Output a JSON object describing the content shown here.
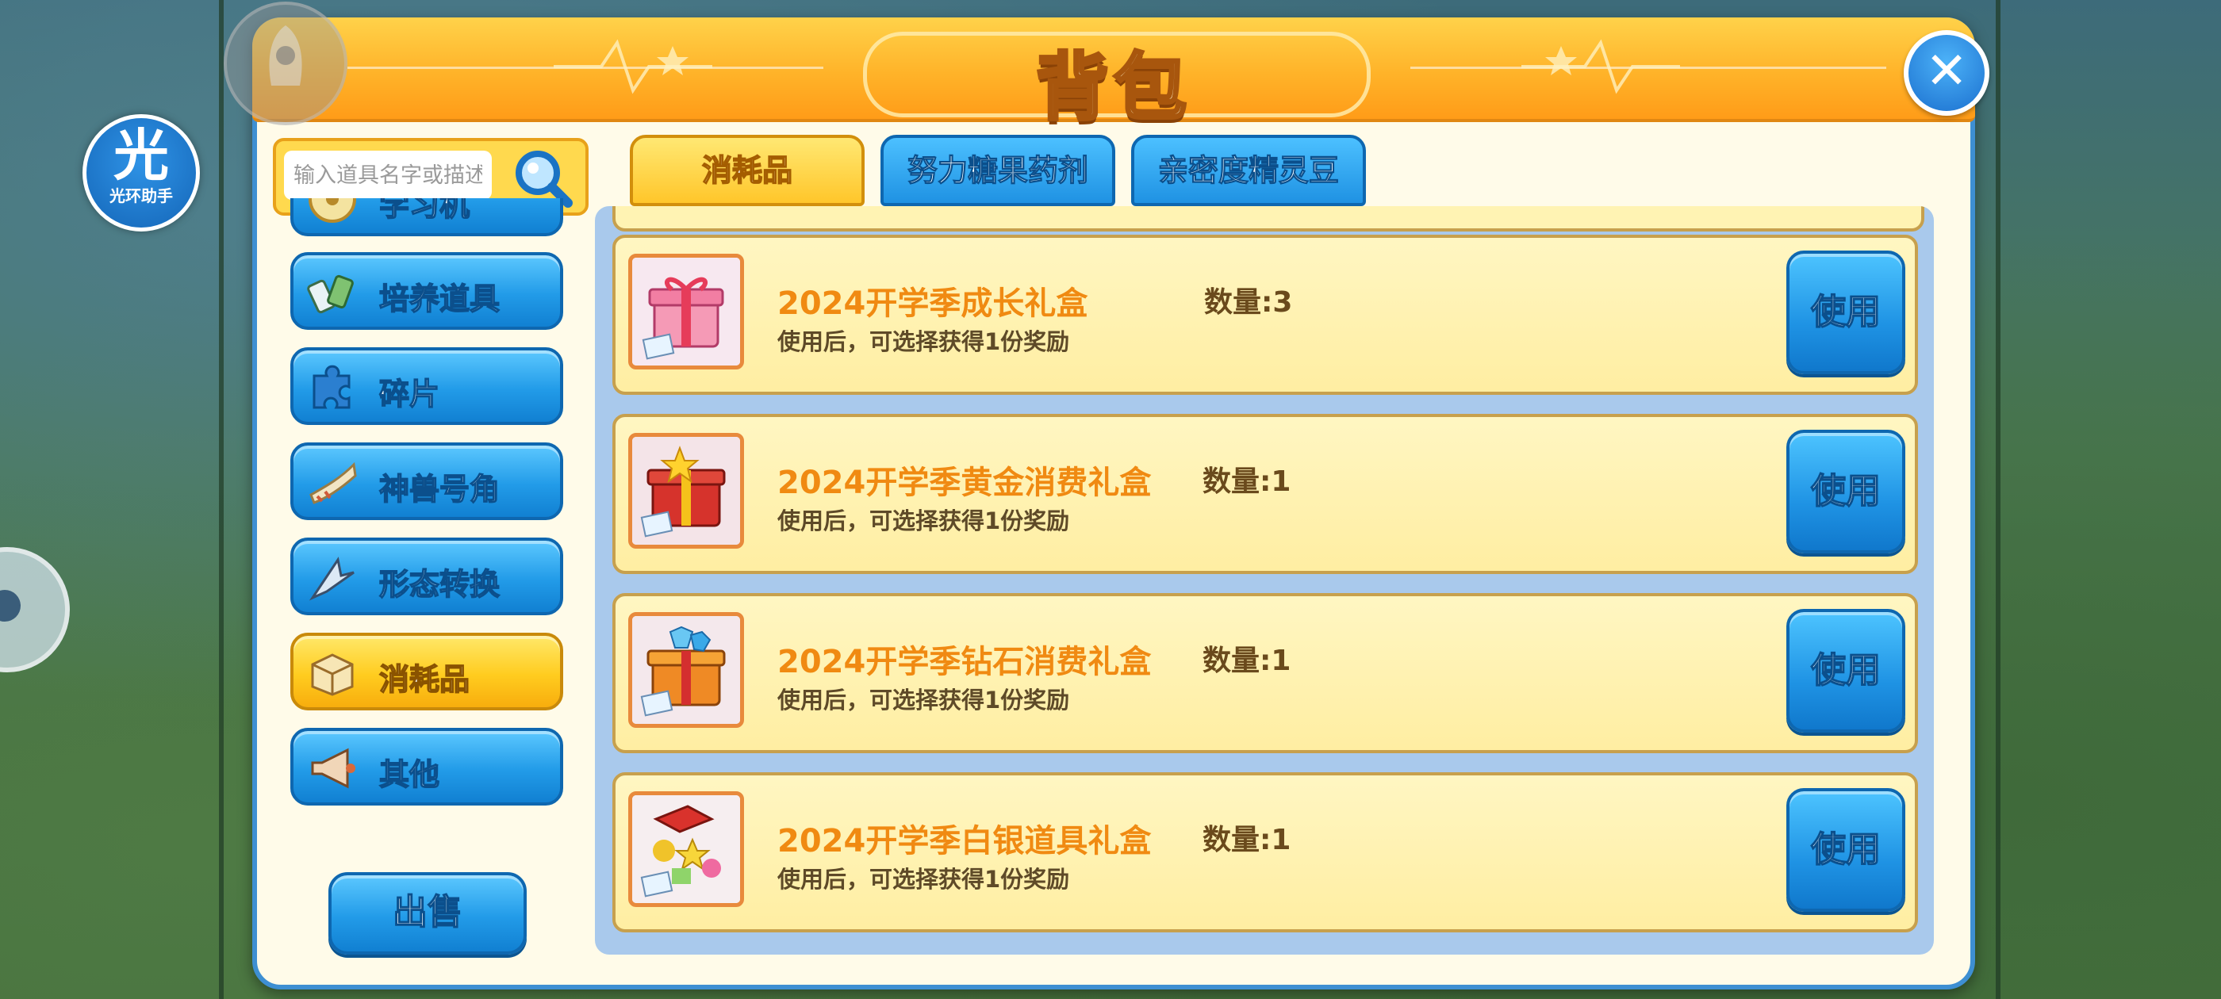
{
  "header": {
    "title": "背包"
  },
  "helper": {
    "glyph": "光",
    "label": "光环助手"
  },
  "search": {
    "placeholder": "输入道具名字或描述"
  },
  "categories": [
    {
      "label": "学习机",
      "icon": "disc-icon",
      "active": false
    },
    {
      "label": "培养道具",
      "icon": "training-item-icon",
      "active": false
    },
    {
      "label": "碎片",
      "icon": "puzzle-piece-icon",
      "active": false
    },
    {
      "label": "神兽号角",
      "icon": "horn-icon",
      "active": false
    },
    {
      "label": "形态转换",
      "icon": "transform-icon",
      "active": false
    },
    {
      "label": "消耗品",
      "icon": "box-icon",
      "active": true
    },
    {
      "label": "其他",
      "icon": "megaphone-icon",
      "active": false
    }
  ],
  "sell_button": "出售",
  "tabs": [
    {
      "label": "消耗品",
      "active": true
    },
    {
      "label": "努力糖果药剂",
      "active": false
    },
    {
      "label": "亲密度精灵豆",
      "active": false
    }
  ],
  "items": [
    {
      "name": "2024开学季成长礼盒",
      "qty": "数量:3",
      "desc": "使用后，可选择获得1份奖励",
      "button": "使用",
      "icon": "pink-gift-box-icon"
    },
    {
      "name": "2024开学季黄金消费礼盒",
      "qty": "数量:1",
      "desc": "使用后，可选择获得1份奖励",
      "button": "使用",
      "icon": "gold-gift-box-icon"
    },
    {
      "name": "2024开学季钻石消费礼盒",
      "qty": "数量:1",
      "desc": "使用后，可选择获得1份奖励",
      "button": "使用",
      "icon": "diamond-gift-box-icon"
    },
    {
      "name": "2024开学季白银道具礼盒",
      "qty": "数量:1",
      "desc": "使用后，可选择获得1份奖励",
      "button": "使用",
      "icon": "silver-gift-box-icon"
    }
  ],
  "colors": {
    "header_orange": "#ffb329",
    "button_blue": "#229be8",
    "active_yellow": "#ffcc1f",
    "item_name_orange": "#f08a12",
    "panel_border": "#3e8fd2"
  }
}
